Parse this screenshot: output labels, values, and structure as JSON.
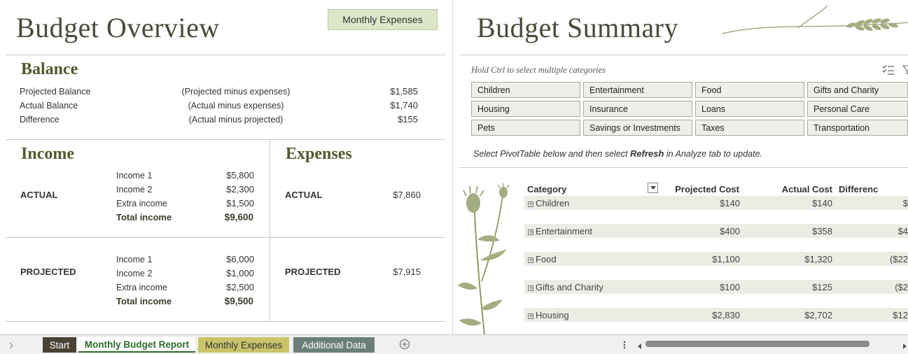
{
  "overview": {
    "title": "Budget Overview",
    "button_label": "Monthly Expenses"
  },
  "balance": {
    "title": "Balance",
    "rows": [
      {
        "label": "Projected Balance",
        "note": "(Projected  minus expenses)",
        "value": "$1,585"
      },
      {
        "label": "Actual Balance",
        "note": "(Actual  minus expenses)",
        "value": "$1,740"
      },
      {
        "label": "Difference",
        "note": "(Actual minus projected)",
        "value": "$155"
      }
    ]
  },
  "income": {
    "title": "Income",
    "actual": {
      "label": "ACTUAL",
      "rows": [
        {
          "label": "Income 1",
          "value": "$5,800"
        },
        {
          "label": "Income 2",
          "value": "$2,300"
        },
        {
          "label": "Extra income",
          "value": "$1,500"
        }
      ],
      "total_label": "Total income",
      "total_value": "$9,600"
    },
    "projected": {
      "label": "PROJECTED",
      "rows": [
        {
          "label": "Income 1",
          "value": "$6,000"
        },
        {
          "label": "Income 2",
          "value": "$1,000"
        },
        {
          "label": "Extra income",
          "value": "$2,500"
        }
      ],
      "total_label": "Total income",
      "total_value": "$9,500"
    }
  },
  "expenses": {
    "title": "Expenses",
    "actual_label": "ACTUAL",
    "actual_value": "$7,860",
    "projected_label": "PROJECTED",
    "projected_value": "$7,915"
  },
  "summary": {
    "title": "Budget Summary",
    "hint": "Hold Ctrl to select multiple categories",
    "slicer_items": [
      "Children",
      "Entertainment",
      "Food",
      "Gifts and Charity",
      "Housing",
      "Insurance",
      "Loans",
      "Personal Care",
      "Pets",
      "Savings or Investments",
      "Taxes",
      "Transportation"
    ],
    "instruction_pre": "Select PivotTable below and then select ",
    "instruction_bold": "Refresh",
    "instruction_post": " in Analyze tab to update.",
    "multi_select_icon": "multi-select-icon",
    "clear_filter_icon": "clear-filter-icon"
  },
  "pivot": {
    "headers": {
      "category": "Category",
      "projected": "Projected Cost",
      "actual": "Actual Cost",
      "difference": "Differenc"
    },
    "rows": [
      {
        "category": "Children",
        "projected": "$140",
        "actual": "$140",
        "difference": "$"
      },
      {
        "category": "Entertainment",
        "projected": "$400",
        "actual": "$358",
        "difference": "$4"
      },
      {
        "category": "Food",
        "projected": "$1,100",
        "actual": "$1,320",
        "difference": "($22"
      },
      {
        "category": "Gifts and Charity",
        "projected": "$100",
        "actual": "$125",
        "difference": "($2"
      },
      {
        "category": "Housing",
        "projected": "$2,830",
        "actual": "$2,702",
        "difference": "$12"
      }
    ]
  },
  "sheet_tabs": {
    "items": [
      {
        "label": "Start",
        "bg": "#4a4335",
        "fg": "#ffffff"
      },
      {
        "label": "Monthly Budget Report",
        "bg": "#ffffff",
        "fg": "#2e6b2e"
      },
      {
        "label": "Monthly Expenses",
        "bg": "#c9c46a",
        "fg": "#333333"
      },
      {
        "label": "Additional Data",
        "bg": "#6b7f78",
        "fg": "#ffffff"
      }
    ],
    "add_icon": "plus-circle-icon",
    "more_icon": "vertical-dots-icon"
  },
  "colors": {
    "accent_green": "#4f5a2e",
    "button_bg": "#dde6c9",
    "band_bg": "#ecece4"
  }
}
